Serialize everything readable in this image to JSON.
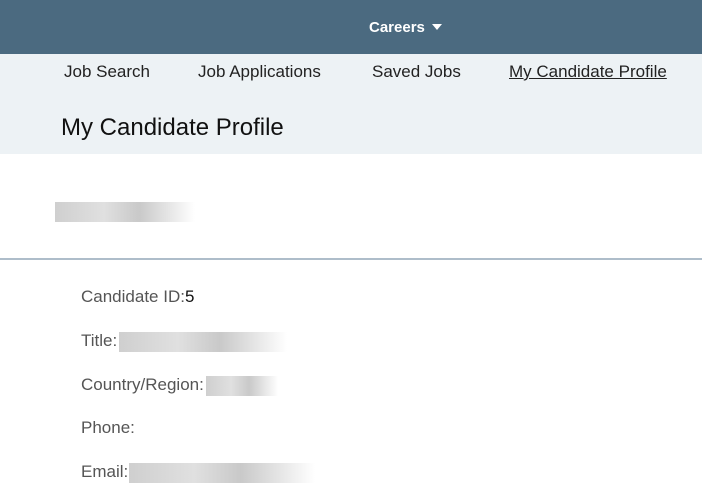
{
  "header": {
    "menu_label": "Careers",
    "menu_icon": "caret-down-icon",
    "bar_color": "#4b6a80"
  },
  "nav": {
    "items": [
      {
        "label": "Job Search"
      },
      {
        "label": "Job Applications"
      },
      {
        "label": "Saved Jobs"
      },
      {
        "label": "My Candidate Profile",
        "active": true
      }
    ]
  },
  "page": {
    "title": "My Candidate Profile"
  },
  "profile": {
    "fields": [
      {
        "label": "Candidate ID:",
        "value": "5"
      },
      {
        "label": "Title:",
        "value": ""
      },
      {
        "label": "Country/Region:",
        "value": ""
      },
      {
        "label": "Phone:",
        "value": ""
      },
      {
        "label": "Email:",
        "value": ""
      }
    ]
  }
}
